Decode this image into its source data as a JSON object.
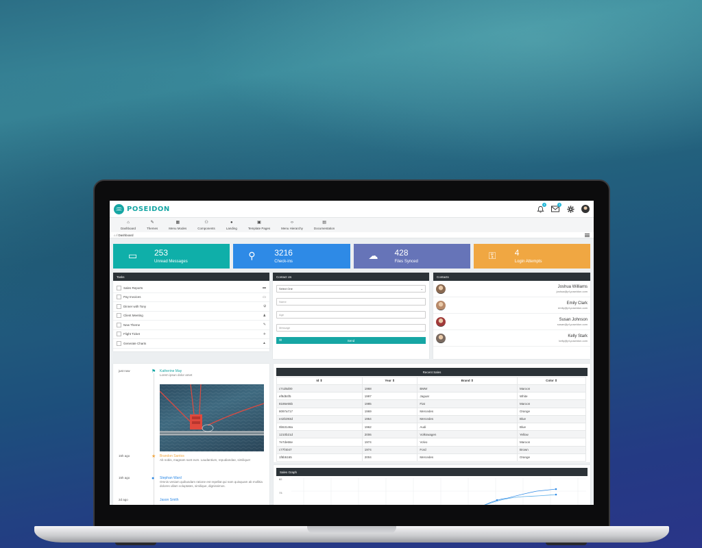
{
  "app": {
    "name": "POSEIDON",
    "notif_badge": "4",
    "mail_badge": "3"
  },
  "nav": [
    {
      "label": "Dashboard",
      "icon": "home-icon",
      "glyph": "⌂"
    },
    {
      "label": "Themes",
      "icon": "brush-icon",
      "glyph": "✎"
    },
    {
      "label": "Menu Modes",
      "icon": "grid-icon",
      "glyph": "▦"
    },
    {
      "label": "Components",
      "icon": "sitemap-icon",
      "glyph": "⚇"
    },
    {
      "label": "Landing",
      "icon": "circle-icon",
      "glyph": "●"
    },
    {
      "label": "Template Pages",
      "icon": "pages-icon",
      "glyph": "▣"
    },
    {
      "label": "Menu Hierarchy",
      "icon": "code-icon",
      "glyph": "‹›"
    },
    {
      "label": "Documentation",
      "icon": "book-icon",
      "glyph": "▤"
    }
  ],
  "breadcrumb": {
    "home_glyph": "⌂",
    "text": "/ Dashboard"
  },
  "stats": [
    {
      "value": "253",
      "label": "Unread Messages",
      "color": "#0fafa9",
      "icon": "inbox-icon",
      "glyph": "▭"
    },
    {
      "value": "3216",
      "label": "Check-ins",
      "color": "#2e8ae6",
      "icon": "map-pin-icon",
      "glyph": "⚲"
    },
    {
      "value": "428",
      "label": "Files Synced",
      "color": "#6674b8",
      "icon": "cloud-icon",
      "glyph": "☁"
    },
    {
      "value": "4",
      "label": "Login Attempts",
      "color": "#f0a742",
      "icon": "key-icon",
      "glyph": "⚿"
    }
  ],
  "tasks": {
    "title": "Tasks",
    "items": [
      {
        "label": "Sales Reports",
        "icon": "briefcase-icon",
        "glyph": "▬"
      },
      {
        "label": "Pay Invoices",
        "icon": "credit-card-icon",
        "glyph": "▭"
      },
      {
        "label": "Dinner with Tony",
        "icon": "cutlery-icon",
        "glyph": "ψ"
      },
      {
        "label": "Client Meeting",
        "icon": "user-icon",
        "glyph": "♟"
      },
      {
        "label": "New Theme",
        "icon": "brush-icon",
        "glyph": "✎"
      },
      {
        "label": "Flight Ticket",
        "icon": "plane-icon",
        "glyph": "✈"
      },
      {
        "label": "Generate Charts",
        "icon": "chart-icon",
        "glyph": "▲"
      }
    ]
  },
  "contact_form": {
    "title": "Contact Us",
    "select_value": "Select One",
    "name_placeholder": "Name",
    "age_placeholder": "Age",
    "message_placeholder": "Message",
    "send_label": "Send"
  },
  "contacts": {
    "title": "Contacts",
    "items": [
      {
        "name": "Joshua Williams",
        "email": "joshua@pf-poseidon.com",
        "tone": "#8a6a52"
      },
      {
        "name": "Emily Clark",
        "email": "emily@pf-poseidon.com",
        "tone": "#b88a6a"
      },
      {
        "name": "Susan Johnson",
        "email": "susan@pf-poseidon.com",
        "tone": "#a03a3a"
      },
      {
        "name": "Kelly Stark",
        "email": "kelly@pf-poseidon.com",
        "tone": "#7a6a60"
      }
    ]
  },
  "timeline": [
    {
      "time": "just now",
      "name": "Katherine May",
      "text": "Lorem ipsun dolor amet",
      "color": "#16a6a4",
      "icon": "signpost-icon",
      "glyph": "⚑"
    },
    {
      "time": "15h ago",
      "name": "Brandon Santos",
      "text": "Ab nobis, magnam sunt eum. Laudantium, repudiandae, similique!",
      "color": "#f0a742",
      "icon": "star-icon",
      "glyph": "★"
    },
    {
      "time": "15h ago",
      "name": "Stephan Ward",
      "text": "Omnis veniam quibusdam ratione est repellat qui nam quisquam ab mollitia dolores ullam voluptates, similique, dignissimos.",
      "color": "#2e8ae6",
      "icon": "comment-icon",
      "glyph": "●"
    },
    {
      "time": "2d ago",
      "name": "Jason Smith",
      "text": "",
      "color": "#2e8ae6",
      "icon": "",
      "glyph": ""
    }
  ],
  "recent_sales": {
    "title": "Recent Sales",
    "columns": [
      "Id ⇕",
      "Year ⇕",
      "Brand ⇕",
      "Color ⇕"
    ],
    "rows": [
      [
        "c7cd6d00",
        "1968",
        "BMW",
        "Maroon"
      ],
      [
        "ef9d84f5",
        "1997",
        "Jaguar",
        "White"
      ],
      [
        "8186e55b",
        "1985",
        "Fiat",
        "Maroon"
      ],
      [
        "8097a717",
        "1969",
        "Mercedes",
        "Orange"
      ],
      [
        "e42b393d",
        "1964",
        "Mercedes",
        "Blue"
      ],
      [
        "0b53146a",
        "1962",
        "Audi",
        "Blue"
      ],
      [
        "1210b21d",
        "2006",
        "Volkswagen",
        "Yellow"
      ],
      [
        "7e7de66e",
        "1974",
        "Volvo",
        "Maroon"
      ],
      [
        "c77f4047",
        "1974",
        "Ford",
        "Brown"
      ],
      [
        "1f6b5165",
        "2004",
        "Mercedes",
        "Orange"
      ]
    ]
  },
  "sales_graph": {
    "title": "Sales Graph",
    "tick_top": "82",
    "tick_mid": "73"
  }
}
